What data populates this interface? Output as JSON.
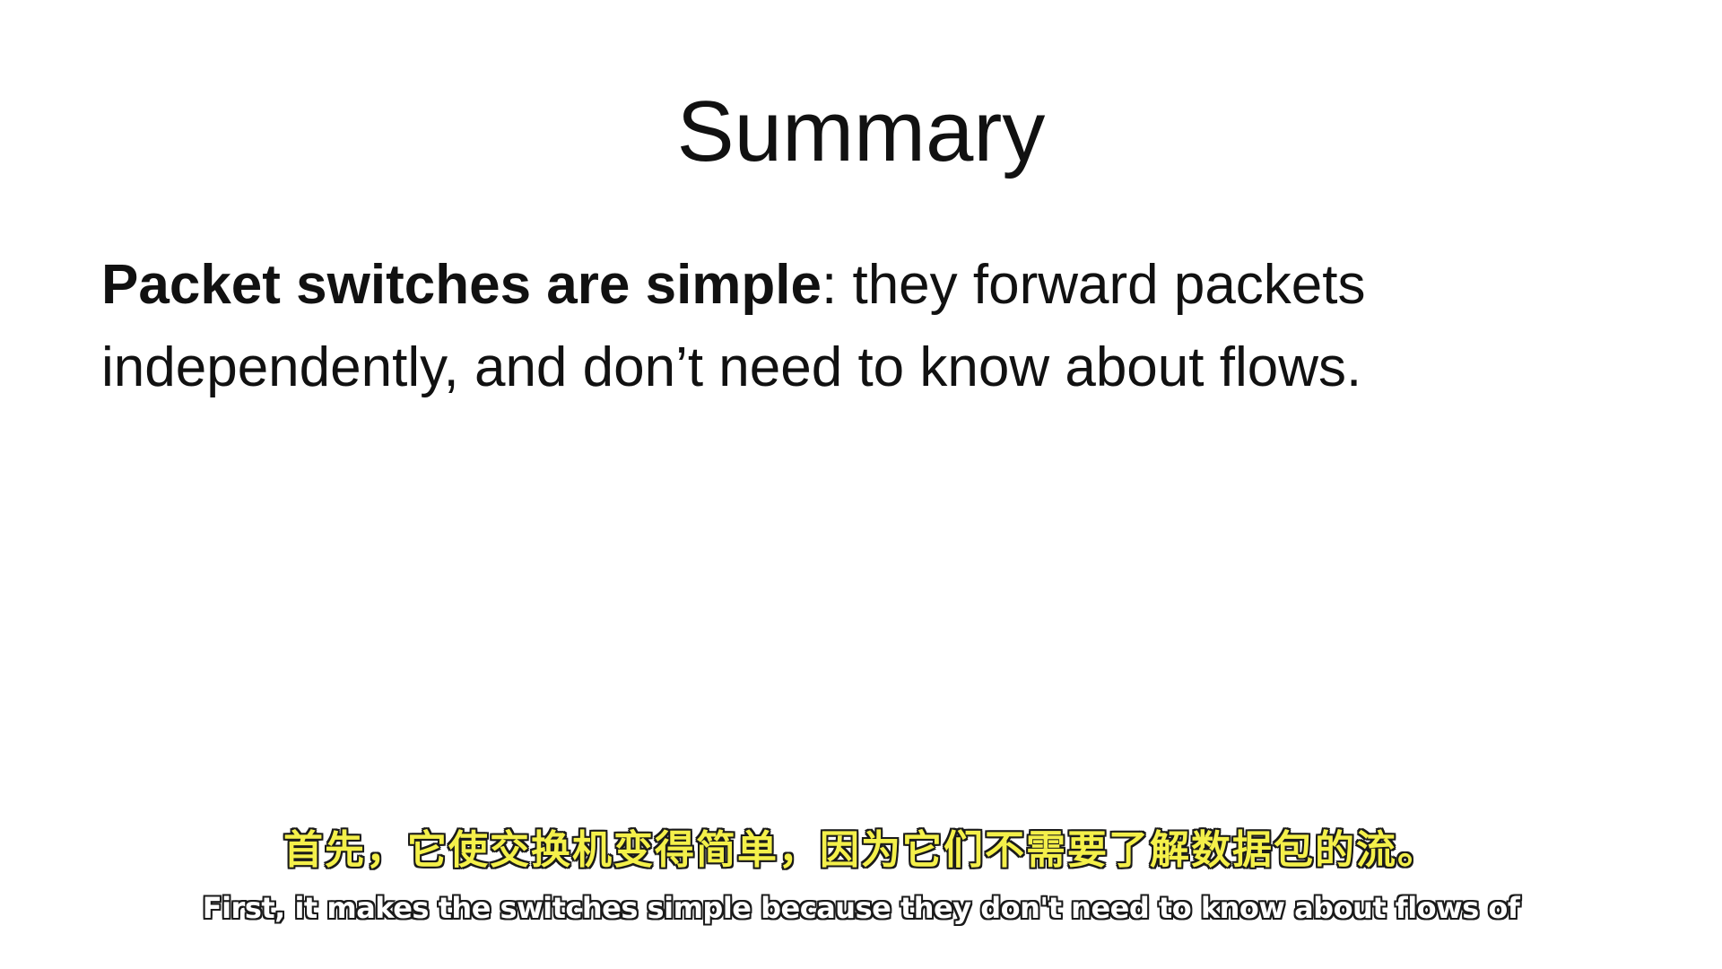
{
  "slide": {
    "title": "Summary",
    "body": {
      "bold_phrase": "Packet switches are simple",
      "line1_rest": ": they forward packets",
      "line2": "independently, and don’t need to know about flows."
    }
  },
  "subtitles": {
    "chinese": "首先，它使交换机变得简单，因为它们不需要了解数据包的流。",
    "english": "First, it makes the switches simple because they don't need to know about flows of"
  },
  "colors": {
    "background": "#ffffff",
    "text": "#111111",
    "subtitle_cn": "#f4f04a",
    "subtitle_en": "#ffffff",
    "subtitle_outline": "#1a1a1a"
  }
}
